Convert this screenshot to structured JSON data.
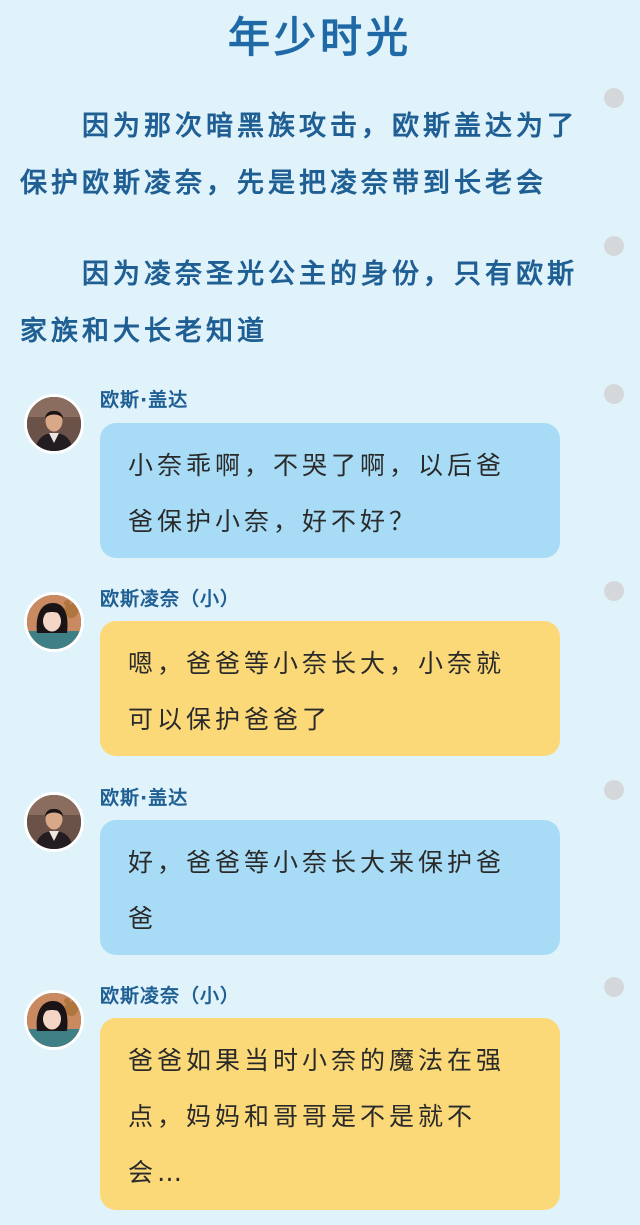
{
  "title": "年少时光",
  "narration": [
    "因为那次暗黑族攻击，欧斯盖达为了保护欧斯凌奈，先是把凌奈带到长老会",
    "因为凌奈圣光公主的身份，只有欧斯家族和大长老知道"
  ],
  "messages": [
    {
      "speaker": "欧斯·盖达",
      "text": "小奈乖啊，不哭了啊，以后爸爸保护小奈，好不好？",
      "avatar": "father-portrait",
      "bubble_color": "#a8dcf6"
    },
    {
      "speaker": "欧斯凌奈（小）",
      "text": "嗯，爸爸等小奈长大，小奈就可以保护爸爸了",
      "avatar": "girl-portrait",
      "bubble_color": "#fbd978"
    },
    {
      "speaker": "欧斯·盖达",
      "text": "好，爸爸等小奈长大来保护爸爸",
      "avatar": "father-portrait",
      "bubble_color": "#a8dcf6"
    },
    {
      "speaker": "欧斯凌奈（小）",
      "text": "爸爸如果当时小奈的魔法在强点，妈妈和哥哥是不是就不会…",
      "avatar": "girl-portrait",
      "bubble_color": "#fbd978"
    }
  ],
  "colors": {
    "background": "#e0f3fb",
    "title": "#1f69a6",
    "narration": "#1f5f93",
    "blue_bubble": "#a8dcf6",
    "yellow_bubble": "#fbd978",
    "scroll_dot": "#d5d8da"
  }
}
